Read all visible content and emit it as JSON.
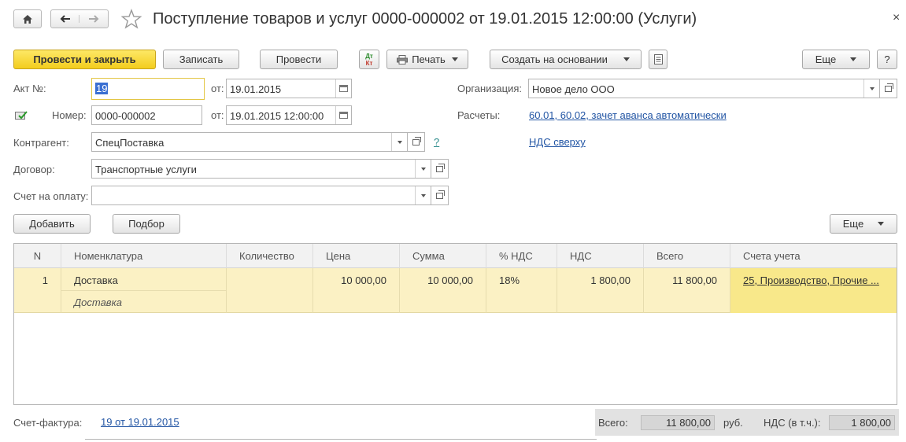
{
  "window": {
    "title": "Поступление товаров и услуг 0000-000002 от 19.01.2015 12:00:00 (Услуги)",
    "close_glyph": "×"
  },
  "toolbar": {
    "post_and_close": "Провести и закрыть",
    "save": "Записать",
    "post": "Провести",
    "dtkt_top": "Дт",
    "dtkt_bottom": "Кт",
    "print": "Печать",
    "create_based_on": "Создать на основании",
    "more": "Еще",
    "help": "?"
  },
  "form": {
    "act_label": "Акт №:",
    "act_value": "19",
    "act_from_label": "от:",
    "act_date": "19.01.2015",
    "number_label": "Номер:",
    "number_value": "0000-000002",
    "number_from_label": "от:",
    "number_date": "19.01.2015 12:00:00",
    "counterparty_label": "Контрагент:",
    "counterparty_value": "СпецПоставка",
    "counterparty_help": "?",
    "contract_label": "Договор:",
    "contract_value": "Транспортные услуги",
    "invoice_label": "Счет на оплату:",
    "invoice_value": "",
    "organization_label": "Организация:",
    "organization_value": "Новое дело ООО",
    "settlements_label": "Расчеты:",
    "settlements_link": "60.01, 60.02, зачет аванса автоматически",
    "vat_link": "НДС сверху"
  },
  "table_toolbar": {
    "add": "Добавить",
    "pick": "Подбор",
    "more": "Еще"
  },
  "table": {
    "columns": [
      "N",
      "Номенклатура",
      "Количество",
      "Цена",
      "Сумма",
      "% НДС",
      "НДС",
      "Всего",
      "Счета учета"
    ],
    "rows": [
      {
        "n": "1",
        "item": "Доставка",
        "item_sub": "Доставка",
        "quantity": "",
        "price": "10 000,00",
        "sum": "10 000,00",
        "vat_rate": "18%",
        "vat": "1 800,00",
        "total": "11 800,00",
        "accounts": "25, Производство, Прочие ..."
      }
    ]
  },
  "footer": {
    "invoice_label": "Счет-фактура:",
    "invoice_link": "19 от 19.01.2015",
    "total_label": "Всего:",
    "total_value": "11 800,00",
    "currency": "руб.",
    "vat_label": "НДС (в т.ч.):",
    "vat_value": "1 800,00"
  },
  "colors": {
    "primary_button": "#f3cd1d",
    "link": "#2255a4",
    "selected_row": "#fbf1c4"
  }
}
